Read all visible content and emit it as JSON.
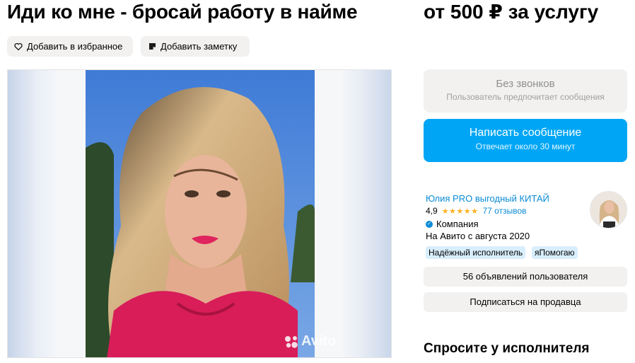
{
  "header": {
    "title": "Иди ко мне - бросай работу в найме",
    "price": "от 500 ₽ за услугу"
  },
  "actions": {
    "favorite_label": "Добавить в избранное",
    "note_label": "Добавить заметку"
  },
  "gallery": {
    "watermark": "Avito"
  },
  "contact": {
    "no_calls_title": "Без звонков",
    "no_calls_subtitle": "Пользователь предпочитает сообщения",
    "write_title": "Написать сообщение",
    "write_subtitle": "Отвечает около 30 минут"
  },
  "seller": {
    "name": "Юлия PRO выгодный КИТАЙ",
    "rating": "4,9",
    "stars": "★★★★★",
    "reviews": "77 отзывов",
    "type": "Компания",
    "since": "На Авито с августа 2020",
    "badges": [
      "Надёжный исполнитель",
      "яПомогаю"
    ],
    "ads_label": "56 объявлений пользователя",
    "subscribe_label": "Подписаться на продавца"
  },
  "ask": {
    "title": "Спросите у исполнителя"
  },
  "colors": {
    "accent": "#00a6f5",
    "link": "#0a8bd6",
    "star": "#ffb021",
    "badge": "#d8eefc"
  }
}
